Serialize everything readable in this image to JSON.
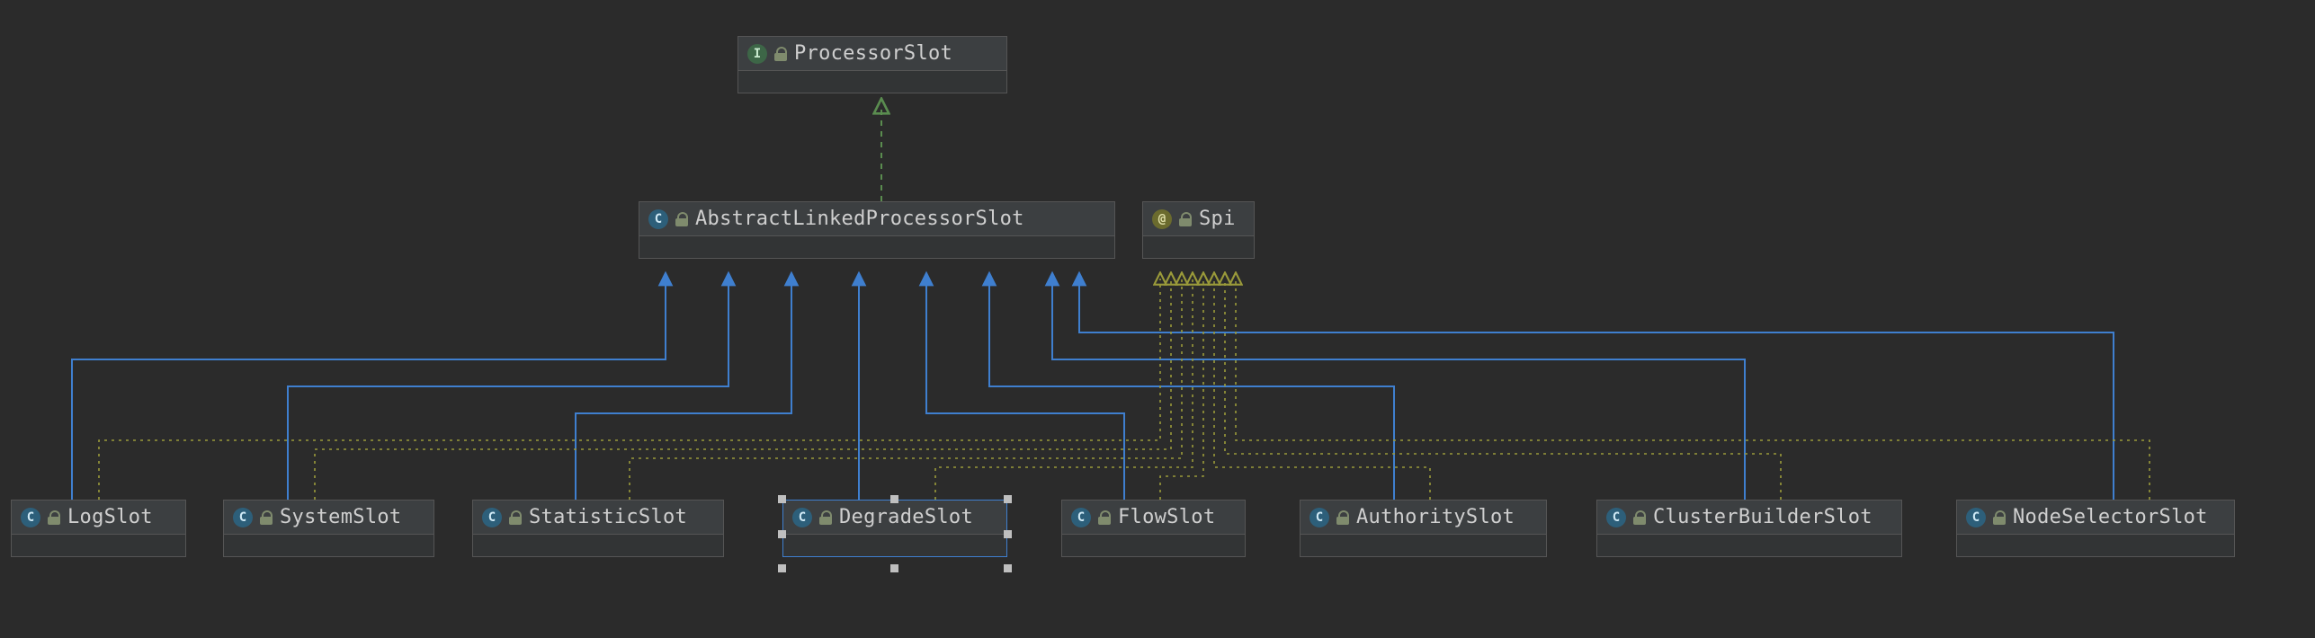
{
  "diagram": {
    "nodes": {
      "processor": {
        "kind": "interface",
        "badge": "I",
        "label": "ProcessorSlot"
      },
      "abstract": {
        "kind": "class",
        "badge": "C",
        "label": "AbstractLinkedProcessorSlot"
      },
      "spi": {
        "kind": "annotation",
        "badge": "@",
        "label": "Spi"
      },
      "log": {
        "kind": "class",
        "badge": "C",
        "label": "LogSlot"
      },
      "system": {
        "kind": "class",
        "badge": "C",
        "label": "SystemSlot"
      },
      "statistic": {
        "kind": "class",
        "badge": "C",
        "label": "StatisticSlot"
      },
      "degrade": {
        "kind": "class",
        "badge": "C",
        "label": "DegradeSlot"
      },
      "flow": {
        "kind": "class",
        "badge": "C",
        "label": "FlowSlot"
      },
      "authority": {
        "kind": "class",
        "badge": "C",
        "label": "AuthoritySlot"
      },
      "cluster": {
        "kind": "class",
        "badge": "C",
        "label": "ClusterBuilderSlot"
      },
      "nodeselector": {
        "kind": "class",
        "badge": "C",
        "label": "NodeSelectorSlot"
      }
    },
    "selected": "degrade",
    "edges_inherit_color": "#3f7fcf",
    "edges_implements_color": "#5a8c4f",
    "edges_annotation_color": "#9a9a3a"
  }
}
